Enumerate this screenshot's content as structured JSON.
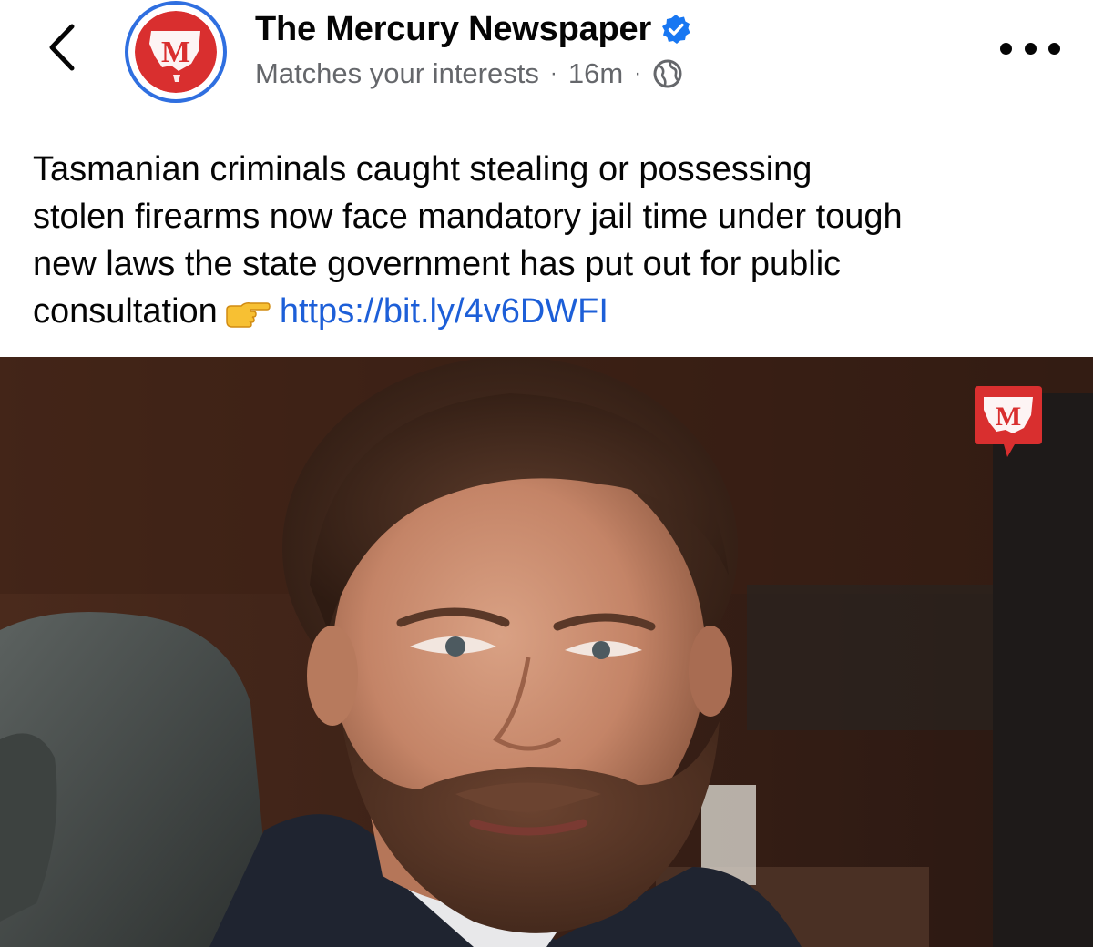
{
  "header": {
    "page_name": "The Mercury Newspaper",
    "meta_reason": "Matches your interests",
    "meta_separator": "·",
    "meta_time": "16m",
    "avatar_letter": "M",
    "badge_letter": "M"
  },
  "post": {
    "line1": "Tasmanian criminals caught stealing or possessing",
    "line2": "stolen firearms now face mandatory jail time under tough",
    "line3": "new laws the state government has put out for public",
    "line4": "consultation",
    "link": "https://bit.ly/4v6DWFI",
    "emoji": "👉"
  },
  "icons": {
    "back": "chevron-left-icon",
    "verified": "verified-badge-icon",
    "audience": "globe-icon",
    "more": "more-horizontal-icon"
  },
  "colors": {
    "brand_red": "#d92f2f",
    "avatar_ring": "#2f6fe0",
    "verified_blue": "#1877f2",
    "link_blue": "#1d5fd8",
    "meta_grey": "#65676b"
  }
}
